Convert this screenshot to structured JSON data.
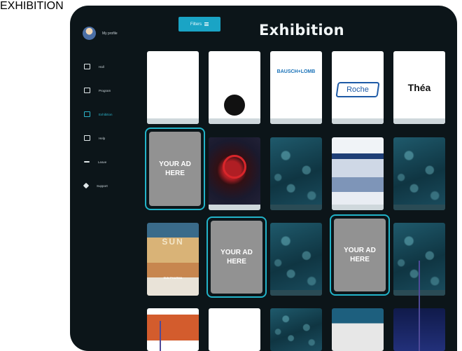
{
  "page": {
    "vertical_title": "EXHIBITION"
  },
  "app": {
    "title": "Exhibition",
    "filter_label": "Filters"
  },
  "profile": {
    "name": "My profile"
  },
  "sidebar": {
    "items": [
      {
        "label": "Hall",
        "icon": "grid-icon"
      },
      {
        "label": "Program",
        "icon": "calendar-icon"
      },
      {
        "label": "Exhibition",
        "icon": "exhibition-icon",
        "active": true
      },
      {
        "label": "Help",
        "icon": "book-icon"
      },
      {
        "label": "Leave",
        "icon": "exit-icon"
      },
      {
        "label": "Support",
        "icon": "support-icon"
      }
    ]
  },
  "ads": {
    "label_line1": "YOUR AD",
    "label_line2": "HERE"
  },
  "exhibitors": {
    "roche": "Roche",
    "thea": "Théa",
    "bausch": "BAUSCH+LOMB",
    "sun": "SUN",
    "sun_caption": "SUN PHARMA"
  },
  "colors": {
    "accent": "#1aa4c5",
    "frame": "#22b3c8",
    "title_purple": "#4f4a98",
    "background": "#0c1519"
  }
}
